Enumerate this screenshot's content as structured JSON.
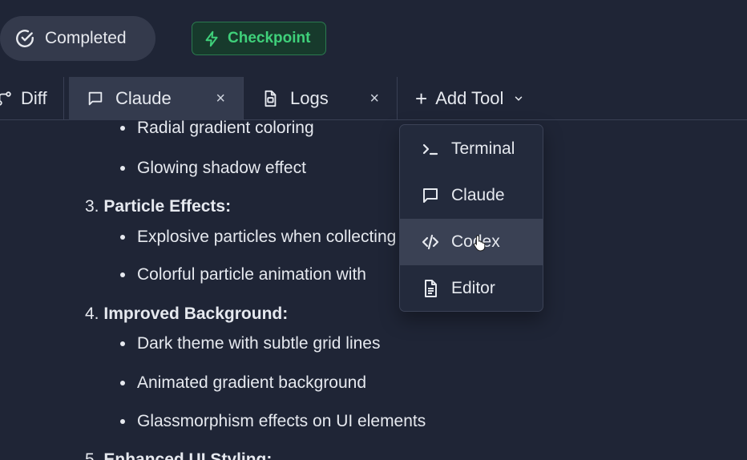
{
  "status": {
    "completed_label": "Completed",
    "checkpoint_label": "Checkpoint",
    "checkpoint_color": "#3fd07a"
  },
  "tabs": [
    {
      "label": "Diff",
      "icon": "branch-icon"
    },
    {
      "label": "Claude",
      "icon": "chat-icon",
      "active": true,
      "closable": true
    },
    {
      "label": "Logs",
      "icon": "log-file-icon",
      "closable": true
    }
  ],
  "close_glyph": "×",
  "add_tool": {
    "label": "Add Tool",
    "plus": "+",
    "menu": [
      {
        "label": "Terminal",
        "icon": "terminal-icon"
      },
      {
        "label": "Claude",
        "icon": "chat-icon"
      },
      {
        "label": "Codex",
        "icon": "code-icon",
        "hovered": true
      },
      {
        "label": "Editor",
        "icon": "document-icon"
      }
    ]
  },
  "content": {
    "items": [
      {
        "type": "bullet",
        "text": "Radial gradient coloring"
      },
      {
        "type": "bullet",
        "text": "Glowing shadow effect"
      },
      {
        "type": "heading",
        "number": "3.",
        "title": "Particle Effects",
        "suffix": ":"
      },
      {
        "type": "bullet",
        "text": "Explosive particles when collecting"
      },
      {
        "type": "bullet",
        "text": "Colorful particle animation with"
      },
      {
        "type": "heading",
        "number": "4.",
        "title": "Improved Background",
        "suffix": ":"
      },
      {
        "type": "bullet",
        "text": "Dark theme with subtle grid lines"
      },
      {
        "type": "bullet",
        "text": "Animated gradient background"
      },
      {
        "type": "bullet",
        "text": "Glassmorphism effects on UI elements"
      },
      {
        "type": "heading",
        "number": "5.",
        "title": "Enhanced UI Styling",
        "suffix": ":"
      }
    ]
  },
  "colors": {
    "background": "#1f2536",
    "active_tab": "#343b4e",
    "menu_hover": "#3a4154"
  }
}
